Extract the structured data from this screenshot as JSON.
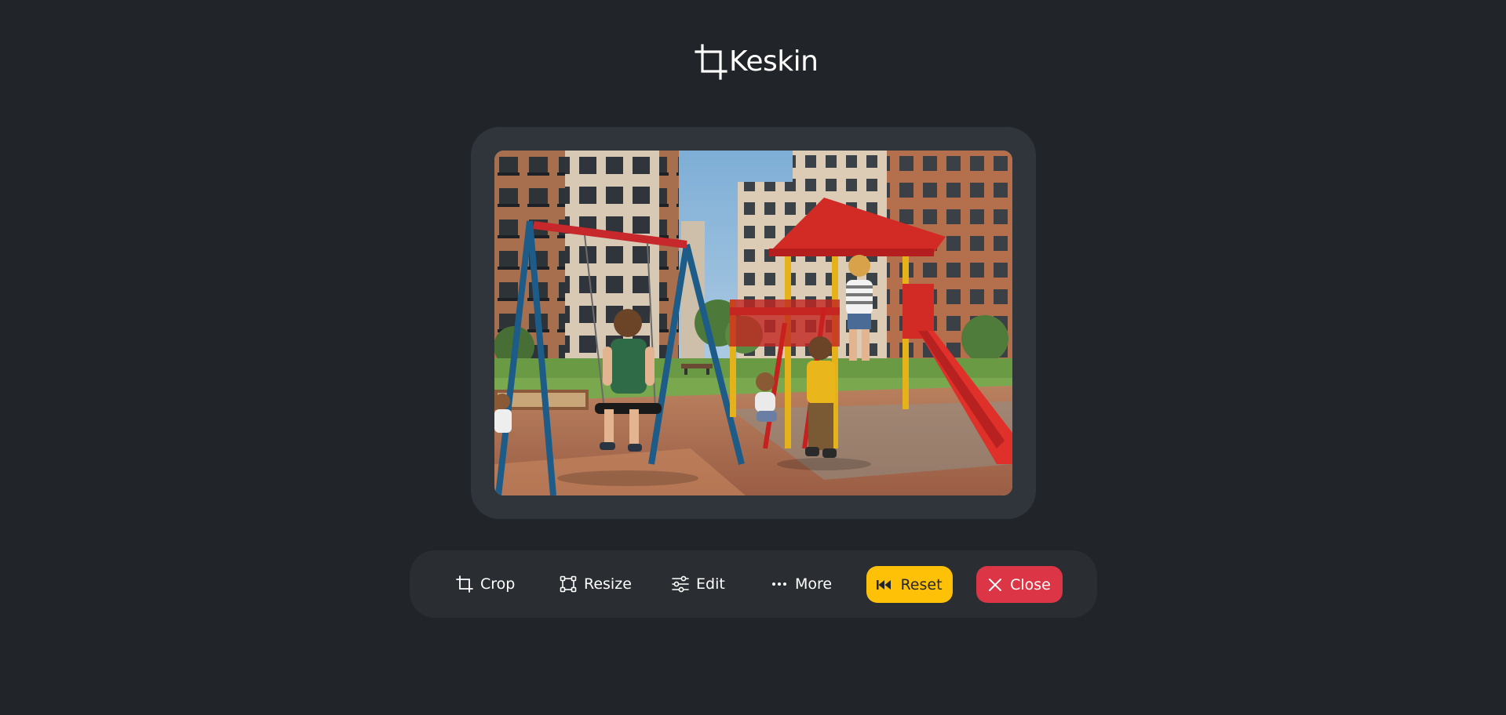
{
  "app": {
    "title": "Keskin",
    "logo_icon": "crop-icon"
  },
  "image": {
    "alt": "Children playing on a playground with swings, a slide and climbing frame in front of apartment buildings"
  },
  "toolbar": {
    "items": [
      {
        "label": "Crop",
        "icon": "crop-icon"
      },
      {
        "label": "Resize",
        "icon": "bounding-box-icon"
      },
      {
        "label": "Edit",
        "icon": "sliders-icon"
      },
      {
        "label": "More",
        "icon": "three-dots-icon"
      }
    ],
    "reset": {
      "label": "Reset",
      "icon": "rewind-icon",
      "color": "#ffc107"
    },
    "close": {
      "label": "Close",
      "icon": "x-icon",
      "color": "#dc3545"
    }
  },
  "colors": {
    "background": "#212429",
    "frame": "#30343b",
    "toolbar": "#2a2e33"
  }
}
